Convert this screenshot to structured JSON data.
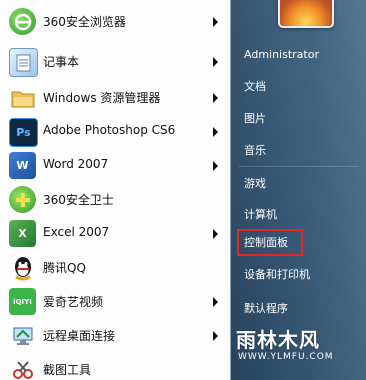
{
  "programs": [
    {
      "label": "360安全浏览器",
      "icon": "360-browser-icon",
      "arrow": true
    },
    {
      "label": "记事本",
      "icon": "notepad-icon",
      "arrow": true
    },
    {
      "label": "Windows 资源管理器",
      "icon": "explorer-icon",
      "arrow": true
    },
    {
      "label": "Adobe Photoshop CS6",
      "icon": "photoshop-icon",
      "arrow": true
    },
    {
      "label": "Word 2007",
      "icon": "word-icon",
      "arrow": true
    },
    {
      "label": "360安全卫士",
      "icon": "360-safe-icon",
      "arrow": false
    },
    {
      "label": "Excel 2007",
      "icon": "excel-icon",
      "arrow": true
    },
    {
      "label": "腾讯QQ",
      "icon": "qq-icon",
      "arrow": false
    },
    {
      "label": "爱奇艺视频",
      "icon": "iqiyi-icon",
      "arrow": true
    },
    {
      "label": "远程桌面连接",
      "icon": "remote-desktop-icon",
      "arrow": true
    },
    {
      "label": "截图工具",
      "icon": "snipping-tool-icon",
      "arrow": false
    }
  ],
  "icon_text": {
    "ps": "Ps",
    "word": "W",
    "excel": "X",
    "iqiyi": "iQIYI"
  },
  "right_menu": {
    "administrator": "Administrator",
    "documents": "文档",
    "pictures": "图片",
    "music": "音乐",
    "games": "游戏",
    "computer": "计算机",
    "control_panel": "控制面板",
    "devices_printers": "设备和打印机",
    "default_programs": "默认程序"
  },
  "highlighted_item": "控制面板",
  "watermark": {
    "title": "雨林木风",
    "url": "WWW.YLMFU.COM"
  },
  "colors": {
    "highlight_border": "#e12727",
    "right_pane": "#3a5c7a"
  }
}
